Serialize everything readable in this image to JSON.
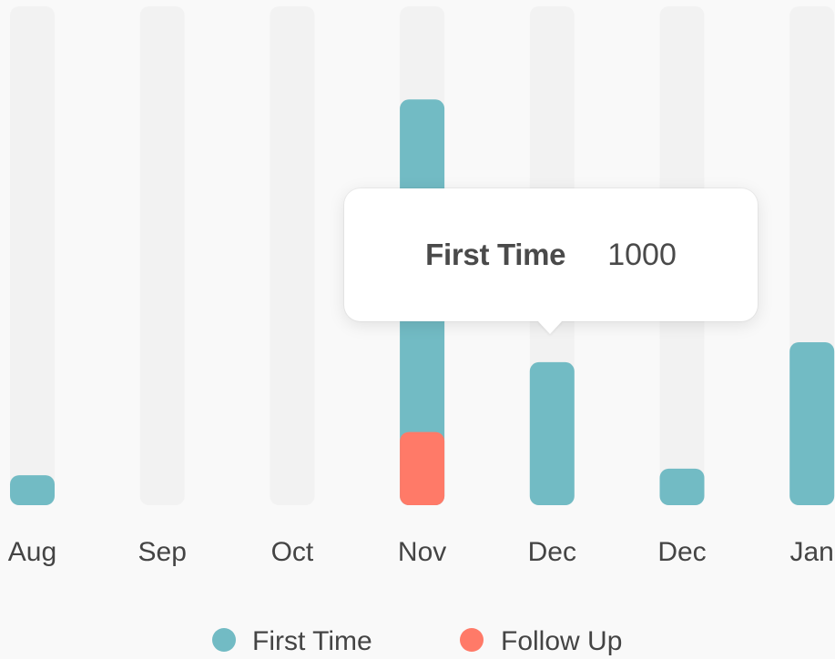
{
  "chart_data": {
    "type": "bar",
    "stacked": true,
    "categories": [
      "Aug",
      "Sep",
      "Oct",
      "Nov",
      "Dec",
      "Dec",
      "Jan"
    ],
    "ylim": [
      0,
      1500
    ],
    "series": [
      {
        "name": "First Time",
        "color": "#72bbc4",
        "values": [
          90,
          0,
          0,
          1000,
          430,
          110,
          490
        ]
      },
      {
        "name": "Follow Up",
        "color": "#ff7a68",
        "values": [
          0,
          0,
          0,
          220,
          0,
          0,
          0
        ]
      }
    ],
    "track_color": "#f2f2f2",
    "legend": {
      "position": "bottom-center",
      "items": [
        {
          "label": "First Time",
          "color": "#72bbc4"
        },
        {
          "label": "Follow Up",
          "color": "#ff7a68"
        }
      ]
    },
    "tooltip": {
      "series": "First Time",
      "value": "1000",
      "category": "Nov"
    }
  }
}
